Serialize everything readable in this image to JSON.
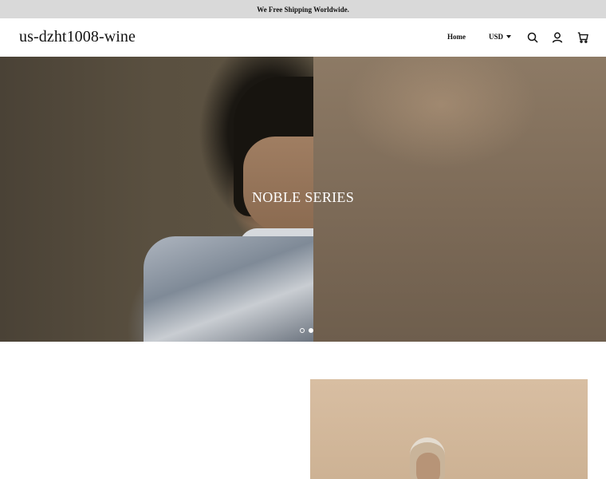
{
  "announcement": "We Free Shipping Worldwide.",
  "header": {
    "brand": "us-dzht1008-wine",
    "nav": {
      "home_label": "Home"
    },
    "currency": "USD",
    "icons": [
      "search-icon",
      "account-icon",
      "cart-icon"
    ]
  },
  "hero": {
    "title": "NOBLE SERIES",
    "slides": 2,
    "active_slide": 2
  },
  "colors": {
    "announcement_bg": "#d9d9d9",
    "text": "#111111",
    "hero_text": "#ffffff"
  }
}
